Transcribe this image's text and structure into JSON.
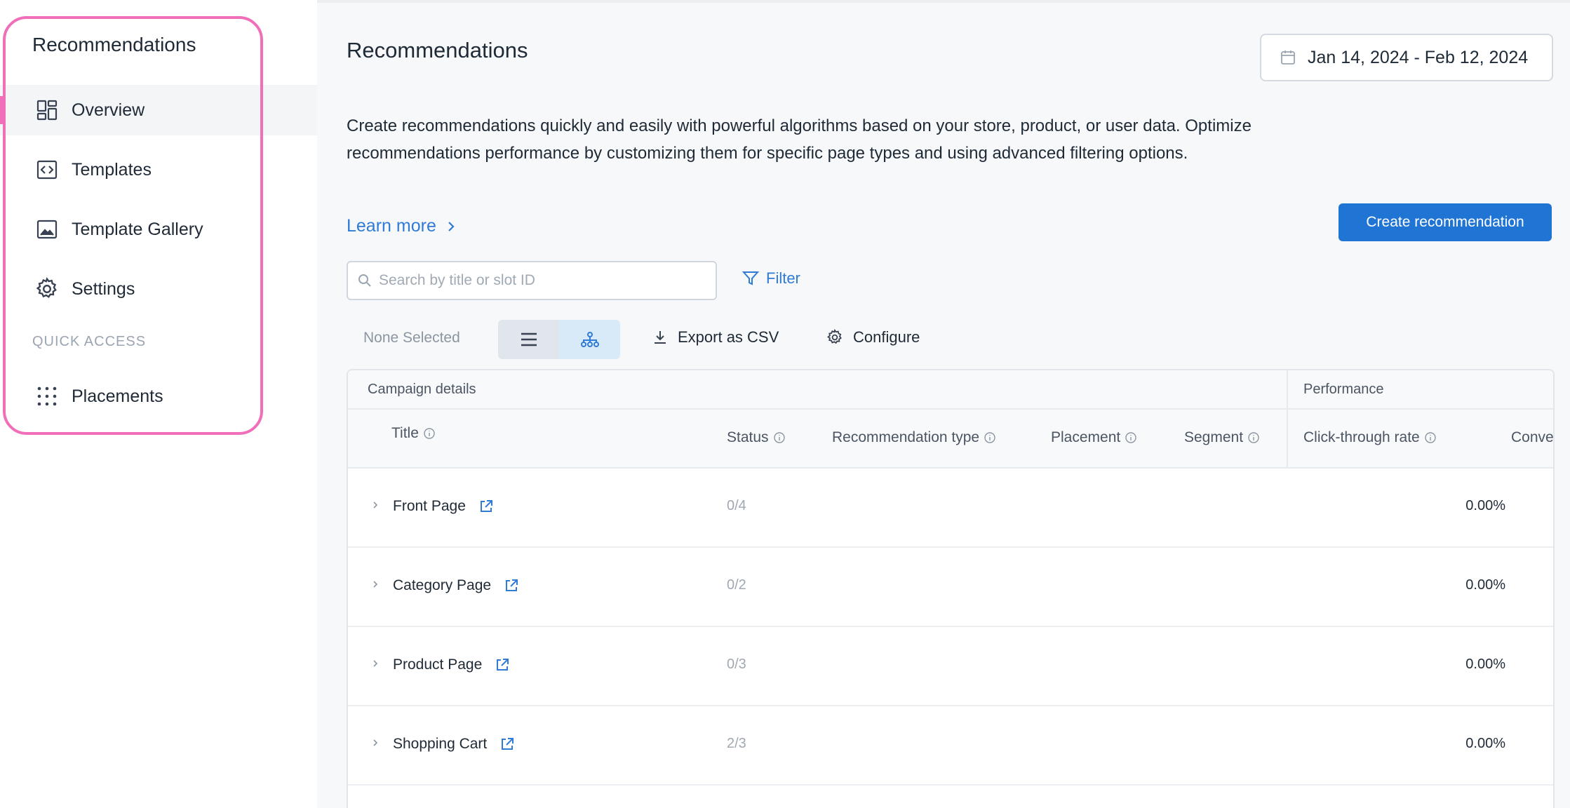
{
  "sidebar": {
    "title": "Recommendations",
    "items": [
      {
        "label": "Overview",
        "icon": "dashboard-icon",
        "active": true
      },
      {
        "label": "Templates",
        "icon": "code-icon"
      },
      {
        "label": "Template Gallery",
        "icon": "image-icon"
      },
      {
        "label": "Settings",
        "icon": "gear-icon"
      }
    ],
    "section_label": "QUICK ACCESS",
    "quick_items": [
      {
        "label": "Placements",
        "icon": "grid-dots-icon"
      }
    ]
  },
  "header": {
    "title": "Recommendations",
    "date_range": "Jan 14, 2024 - Feb 12, 2024"
  },
  "description": "Create recommendations quickly and easily with powerful algorithms based on your store, product, or user data. Optimize recommendations performance by customizing them for specific page types and using advanced filtering options.",
  "learn_more": "Learn more",
  "create_button": "Create recommendation",
  "search": {
    "placeholder": "Search by title or slot ID",
    "value": ""
  },
  "filter_label": "Filter",
  "toolbar": {
    "selection": "None Selected",
    "export_label": "Export as CSV",
    "configure_label": "Configure"
  },
  "table": {
    "groups": [
      "Campaign details",
      "Performance"
    ],
    "columns": [
      "Title",
      "Status",
      "Recommendation type",
      "Placement",
      "Segment",
      "Click-through rate",
      "Convers"
    ],
    "rows": [
      {
        "title": "Front Page",
        "status": "0/4",
        "ctr": "0.00%"
      },
      {
        "title": "Category Page",
        "status": "0/2",
        "ctr": "0.00%"
      },
      {
        "title": "Product Page",
        "status": "0/3",
        "ctr": "0.00%"
      },
      {
        "title": "Shopping Cart",
        "status": "2/3",
        "ctr": "0.00%"
      }
    ]
  },
  "colors": {
    "accent": "#1f74d4",
    "link": "#2f7bd6",
    "highlight": "#f06fb8"
  }
}
